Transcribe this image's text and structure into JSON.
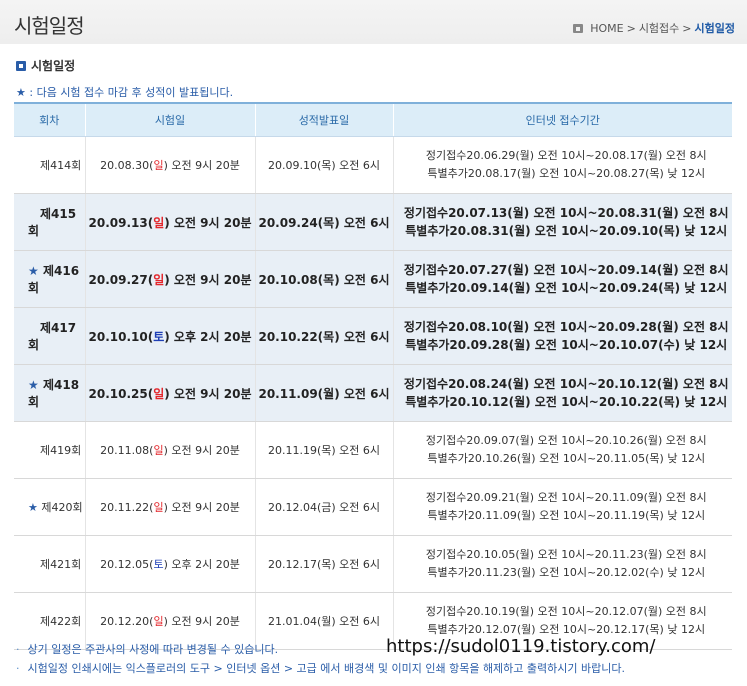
{
  "header": {
    "title": "시험일정",
    "breadcrumb": [
      "HOME",
      "시험접수",
      "시험일정"
    ],
    "separator": ">"
  },
  "section": {
    "title": "시험일정"
  },
  "notice": {
    "star": "★",
    "text": ": 다음 시험 접수 마감 후 성적이 발표됩니다."
  },
  "table": {
    "headers": [
      "회차",
      "시험일",
      "성적발표일",
      "인터넷 접수기간"
    ],
    "rows": [
      {
        "star": false,
        "highlight": false,
        "round": "제414회",
        "exam": {
          "date": "20.08.30",
          "day": "일",
          "dayColor": "red",
          "time": "오전 9시 20분"
        },
        "result": "20.09.10(목) 오전 6시",
        "regular": "정기접수20.06.29(월) 오전 10시~20.08.17(월) 오전 8시",
        "extra": "특별추가20.08.17(월) 오전 10시~20.08.27(목) 낮 12시"
      },
      {
        "star": false,
        "highlight": true,
        "round": "제415회",
        "exam": {
          "date": "20.09.13",
          "day": "일",
          "dayColor": "red",
          "time": "오전 9시 20분"
        },
        "result": "20.09.24(목) 오전 6시",
        "regular": "정기접수20.07.13(월) 오전 10시~20.08.31(월) 오전 8시",
        "extra": "특별추가20.08.31(월) 오전 10시~20.09.10(목) 낮 12시"
      },
      {
        "star": true,
        "highlight": true,
        "round": "제416회",
        "exam": {
          "date": "20.09.27",
          "day": "일",
          "dayColor": "red",
          "time": "오전 9시 20분"
        },
        "result": "20.10.08(목) 오전 6시",
        "regular": "정기접수20.07.27(월) 오전 10시~20.09.14(월) 오전 8시",
        "extra": "특별추가20.09.14(월) 오전 10시~20.09.24(목) 낮 12시"
      },
      {
        "star": false,
        "highlight": true,
        "round": "제417회",
        "exam": {
          "date": "20.10.10",
          "day": "토",
          "dayColor": "blue",
          "time": "오후 2시 20분"
        },
        "result": "20.10.22(목) 오전 6시",
        "regular": "정기접수20.08.10(월) 오전 10시~20.09.28(월) 오전 8시",
        "extra": "특별추가20.09.28(월) 오전 10시~20.10.07(수) 낮 12시"
      },
      {
        "star": true,
        "highlight": true,
        "round": "제418회",
        "exam": {
          "date": "20.10.25",
          "day": "일",
          "dayColor": "red",
          "time": "오전 9시 20분"
        },
        "result": "20.11.09(월) 오전 6시",
        "regular": "정기접수20.08.24(월) 오전 10시~20.10.12(월) 오전 8시",
        "extra": "특별추가20.10.12(월) 오전 10시~20.10.22(목) 낮 12시"
      },
      {
        "star": false,
        "highlight": false,
        "round": "제419회",
        "exam": {
          "date": "20.11.08",
          "day": "일",
          "dayColor": "red",
          "time": "오전 9시 20분"
        },
        "result": "20.11.19(목) 오전 6시",
        "regular": "정기접수20.09.07(월) 오전 10시~20.10.26(월) 오전 8시",
        "extra": "특별추가20.10.26(월) 오전 10시~20.11.05(목) 낮 12시"
      },
      {
        "star": true,
        "highlight": false,
        "round": "제420회",
        "exam": {
          "date": "20.11.22",
          "day": "일",
          "dayColor": "red",
          "time": "오전 9시 20분"
        },
        "result": "20.12.04(금) 오전 6시",
        "regular": "정기접수20.09.21(월) 오전 10시~20.11.09(월) 오전 8시",
        "extra": "특별추가20.11.09(월) 오전 10시~20.11.19(목) 낮 12시"
      },
      {
        "star": false,
        "highlight": false,
        "round": "제421회",
        "exam": {
          "date": "20.12.05",
          "day": "토",
          "dayColor": "blue",
          "time": "오후 2시 20분"
        },
        "result": "20.12.17(목) 오전 6시",
        "regular": "정기접수20.10.05(월) 오전 10시~20.11.23(월) 오전 8시",
        "extra": "특별추가20.11.23(월) 오전 10시~20.12.02(수) 낮 12시"
      },
      {
        "star": false,
        "highlight": false,
        "round": "제422회",
        "exam": {
          "date": "20.12.20",
          "day": "일",
          "dayColor": "red",
          "time": "오전 9시 20분"
        },
        "result": "21.01.04(월) 오전 6시",
        "regular": "정기접수20.10.19(월) 오전 10시~20.12.07(월) 오전 8시",
        "extra": "특별추가20.12.07(월) 오전 10시~20.12.17(목) 낮 12시"
      }
    ]
  },
  "footer": {
    "notes": [
      "상기 일정은 주관사의 사정에 따라 변경될 수 있습니다.",
      "시험일정 인쇄시에는 익스플로러의 도구 > 인터넷 옵션 > 고급 에서 배경색 및 이미지 인쇄 항목을 해제하고 출력하시기 바랍니다."
    ],
    "bullet": "·",
    "url": "https://sudol0119.tistory.com/"
  },
  "colors": {
    "accent": "#2a5da8",
    "sunday": "#e3262b",
    "saturday": "#1f3fb5",
    "headerBg": "#dcedf8",
    "highlightRow": "#e8eff6"
  }
}
